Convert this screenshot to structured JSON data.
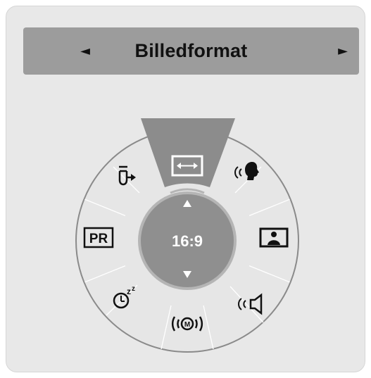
{
  "header": {
    "title": "Billedformat",
    "prev_glyph": "◄",
    "next_glyph": "►"
  },
  "dial": {
    "center_value": "16:9",
    "selected_item": "aspect-ratio",
    "items": [
      {
        "name": "aspect-ratio-icon"
      },
      {
        "name": "clear-voice-icon"
      },
      {
        "name": "picture-mode-icon"
      },
      {
        "name": "sound-mode-icon"
      },
      {
        "name": "mts-icon",
        "label": "M"
      },
      {
        "name": "sleep-timer-icon",
        "label": "zz"
      },
      {
        "name": "program-edit-icon",
        "label": "PR"
      },
      {
        "name": "input-icon"
      }
    ]
  },
  "colors": {
    "panel_bg": "#e8e8e8",
    "header_bg": "#9c9c9c",
    "dial_bg": "#e6e6e6",
    "dial_border": "#8a8a8a",
    "selected_wedge": "#8c8c8c",
    "center_disc": "#8f8f8f",
    "text_dark": "#111111",
    "text_light": "#ffffff"
  }
}
